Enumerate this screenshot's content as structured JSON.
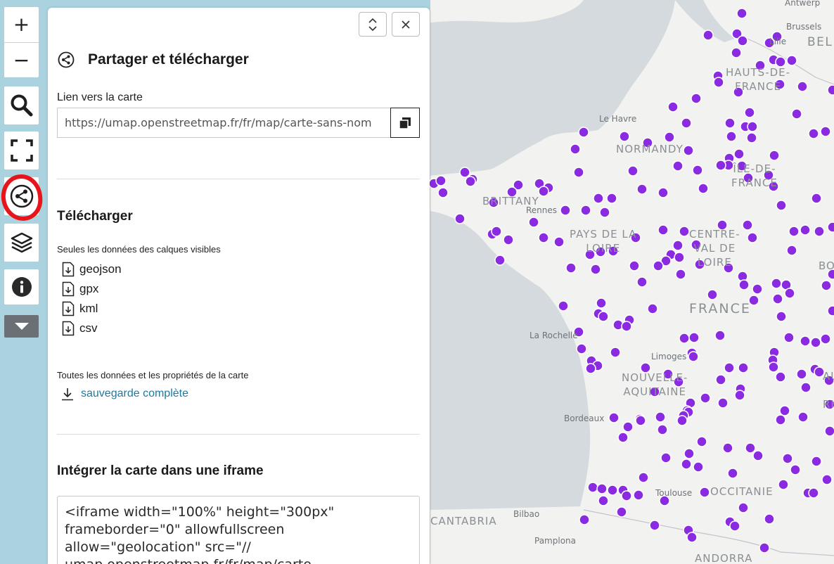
{
  "map": {
    "labels": {
      "antwerp": "Antwerp",
      "brussels": "Brussels",
      "belgium": "BEL",
      "lille": "Lille",
      "hauts_de_france": "HAUTS-DE-\nFRANCE",
      "le_havre": "Le Havre",
      "normandy": "NORMANDY",
      "ile_de_france": "ÎLE-DE-\nFRANCE",
      "brittany": "BRITTANY",
      "rennes": "Rennes",
      "pays_de_la_loire": "PAYS DE LA\nLOIRE",
      "centre_val_de_loire": "CENTRE-\nVAL DE\nLOIRE",
      "france": "FRANCE",
      "la_rochelle": "La Rochelle",
      "limoges": "Limoges",
      "nouvelle_aquitaine": "NOUVELLE-\nAQUITAINE",
      "bordeaux": "Bordeaux",
      "toulouse": "Toulouse",
      "occitanie": "OCCITANIE",
      "cantabria": "CANTABRIA",
      "bilbao": "Bilbao",
      "pamplona": "Pamplona",
      "andorra": "ANDORRA",
      "bo": "BO",
      "au": "AU",
      "rh": "RH"
    },
    "marker_color": "#8a2be2"
  },
  "toolbar": {
    "zoom_in": "+",
    "zoom_out": "−"
  },
  "panel": {
    "title": "Partager et télécharger",
    "link_label": "Lien vers la carte",
    "link_value": "https://umap.openstreetmap.fr/fr/map/carte-sans-nom",
    "download_title": "Télécharger",
    "visible_layers_label": "Seules les données des calques visibles",
    "formats": [
      "geojson",
      "gpx",
      "kml",
      "csv"
    ],
    "all_data_label": "Toutes les données et les propriétés de la carte",
    "full_backup": "sauvegarde complète",
    "iframe_title": "Intégrer la carte dans une iframe",
    "iframe_code": "<iframe width=\"100%\" height=\"300px\"\nframeborder=\"0\" allowfullscreen\nallow=\"geolocation\" src=\"//\numap.openstreetmap.fr/fr/map/carte-"
  }
}
